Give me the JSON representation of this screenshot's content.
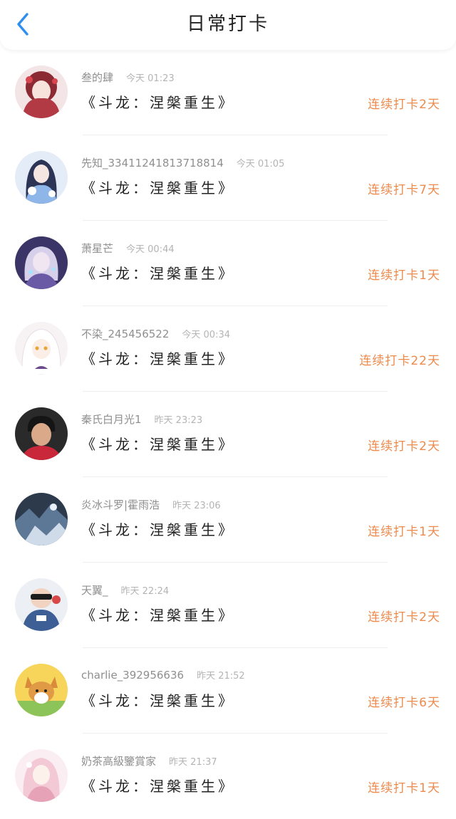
{
  "header": {
    "title": "日常打卡",
    "back_icon": "chevron-left-icon",
    "accent": "#2f8ff0"
  },
  "colors": {
    "streak": "#ee8a4c",
    "book": "#222222",
    "meta": "#9a9a9a"
  },
  "entries": [
    {
      "name": "叁的肆",
      "time": "今天 01:23",
      "book": "《斗龙：涅槃重生》",
      "streak": "连续打卡2天",
      "avatar": "anime-girl-red-avatar"
    },
    {
      "name": "先知_3341124181371881​4",
      "time": "今天 01:05",
      "book": "《斗龙：涅槃重生》",
      "streak": "连续打卡7天",
      "avatar": "anime-girl-blue-avatar"
    },
    {
      "name": "萧星芒",
      "time": "今天 00:44",
      "book": "《斗龙：涅槃重生》",
      "streak": "连续打卡1天",
      "avatar": "anime-girl-purple-avatar"
    },
    {
      "name": "不染_245456522",
      "time": "今天 00:34",
      "book": "《斗龙：涅槃重生》",
      "streak": "连续打卡22天",
      "avatar": "anime-white-hair-avatar"
    },
    {
      "name": "秦氏白月光1",
      "time": "昨天 23:23",
      "book": "《斗龙：涅槃重生》",
      "streak": "连续打卡2天",
      "avatar": "boy-photo-avatar"
    },
    {
      "name": "炎冰斗罗|霍雨浩",
      "time": "昨天 23:06",
      "book": "《斗龙：涅槃重生》",
      "streak": "连续打卡1天",
      "avatar": "dark-art-avatar"
    },
    {
      "name": "天翼_",
      "time": "昨天 22:24",
      "book": "《斗龙：涅槃重生》",
      "streak": "连续打卡2天",
      "avatar": "cartoon-character-avatar"
    },
    {
      "name": "charlie_392956636",
      "time": "昨天 21:52",
      "book": "《斗龙：涅槃重生》",
      "streak": "连续打卡6天",
      "avatar": "corgi-dog-avatar"
    },
    {
      "name": "奶茶高級鑒賞家",
      "time": "昨天 21:37",
      "book": "《斗龙：涅槃重生》",
      "streak": "连续打卡1天",
      "avatar": "anime-girl-pink-avatar"
    }
  ]
}
